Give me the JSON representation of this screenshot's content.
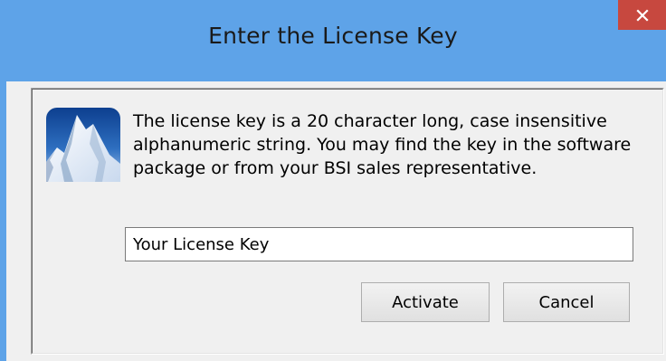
{
  "window": {
    "title": "Enter the License Key",
    "close_icon": "close-icon"
  },
  "dialog": {
    "logo_icon": "mountain-logo",
    "message": "The license key is a 20 character long, case insensitive alphanumeric string. You may find the key in the software package or from your BSI sales representative.",
    "license_input": {
      "value": "Your License Key",
      "placeholder": ""
    },
    "buttons": {
      "activate": "Activate",
      "cancel": "Cancel"
    }
  },
  "colors": {
    "titlebar": "#5ea3e8",
    "close_button": "#c7483f",
    "client_background": "#f0f0f0"
  }
}
